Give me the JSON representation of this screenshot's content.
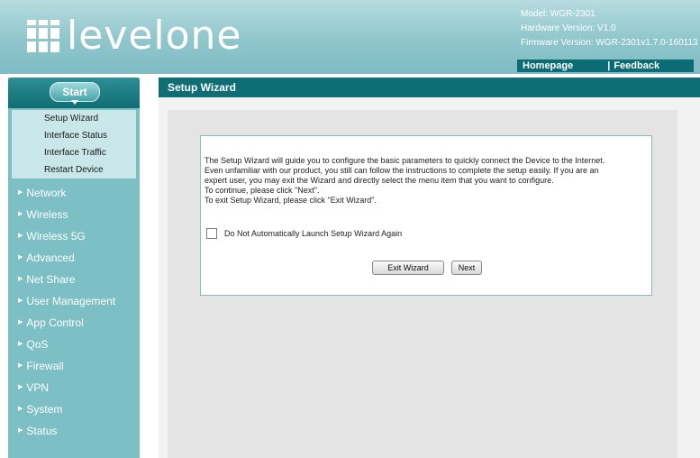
{
  "brand": {
    "logo_text": "levelone"
  },
  "device_info": {
    "model": "Model: WGR-2301",
    "hardware": "Hardware Version: V1.0",
    "firmware": "Firmware Version: WGR-2301v1.7.0-160113"
  },
  "toplinks": {
    "homepage": "Homepage",
    "separator": "|",
    "feedback": "Feedback"
  },
  "sidebar": {
    "start_label": "Start",
    "submenu": [
      "Setup Wizard",
      "Interface Status",
      "Interface Traffic",
      "Restart Device"
    ],
    "items": [
      "Network",
      "Wireless",
      "Wireless 5G",
      "Advanced",
      "Net Share",
      "User Management",
      "App Control",
      "QoS",
      "Firewall",
      "VPN",
      "System",
      "Status"
    ]
  },
  "main": {
    "title": "Setup Wizard",
    "description_lines": [
      "The Setup Wizard will guide you to configure the basic parameters to quickly connect the Device to the Internet.",
      "Even unfamiliar with our product, you still can follow the instructions to complete the setup easily. If you are an",
      "expert user, you may exit the Wizard and directly select the menu item that you want to configure.",
      "To continue, please click \"Next\".",
      "To exit Setup Wizard, please click \"Exit Wizard\"."
    ],
    "checkbox_label": "Do Not Automatically Launch Setup Wizard Again",
    "exit_button": "Exit Wizard",
    "next_button": "Next"
  },
  "colors": {
    "header": "#8fc6cc",
    "sidebar": "#7cc0c5",
    "title_bar": "#0f6d74"
  }
}
